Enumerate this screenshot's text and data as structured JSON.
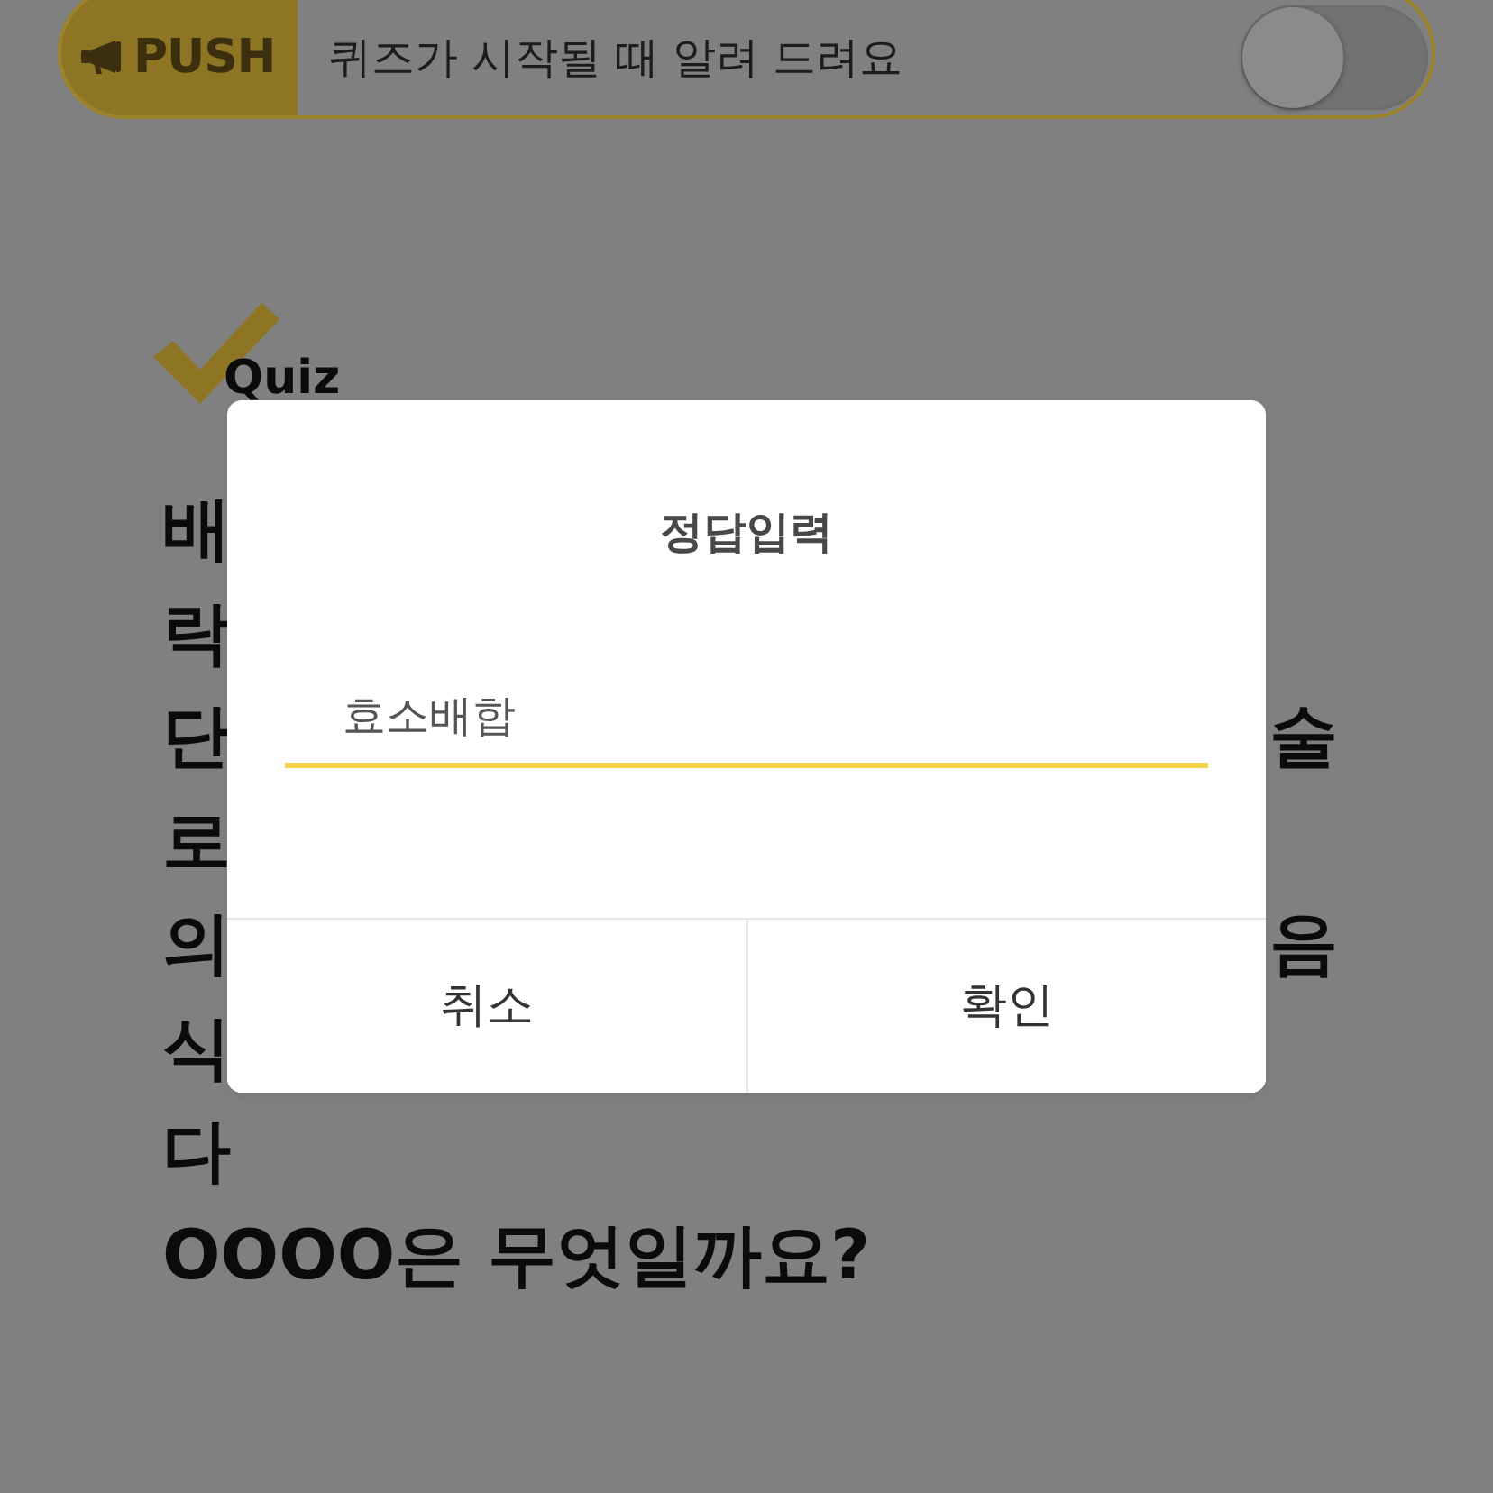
{
  "push_bar": {
    "badge": "PUSH",
    "message": "퀴즈가 시작될 때 알려 드려요",
    "toggle": {
      "on": false
    }
  },
  "quiz": {
    "label": "Quiz",
    "question_lines": [
      {
        "left": "배"
      },
      {
        "left": "락"
      },
      {
        "left": "단",
        "right": "술"
      },
      {
        "left": "로"
      },
      {
        "left": "의",
        "right": "음"
      },
      {
        "left": "식"
      },
      {
        "left": "다"
      },
      {
        "left": "OOOO은 무엇일까요?"
      }
    ]
  },
  "dialog": {
    "title": "정답입력",
    "answer_field": {
      "value": "효소배합"
    },
    "buttons": [
      {
        "label": "취소"
      },
      {
        "label": "확인"
      }
    ]
  }
}
